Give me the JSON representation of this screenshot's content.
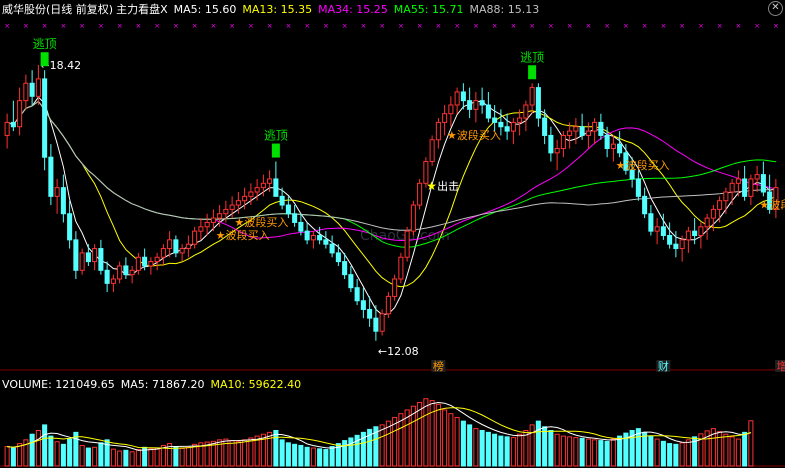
{
  "header": {
    "stock_name": "威华股份(日线 前复权)",
    "indicator_name": "主力看盘X",
    "ma": [
      {
        "label": "MA5: 15.60",
        "color": "#ffffff"
      },
      {
        "label": "MA13: 15.35",
        "color": "#ffff00"
      },
      {
        "label": "MA34: 15.25",
        "color": "#ff00ff"
      },
      {
        "label": "MA55: 15.71",
        "color": "#00ff00"
      },
      {
        "label": "MA88: 15.13",
        "color": "#c0c0c0"
      }
    ],
    "close_icon": "close-x-icon"
  },
  "price_panel": {
    "high_label": "18.42",
    "low_label": "12.08",
    "watermark": "ChaoGu.com",
    "markers_top": [
      {
        "text": "逃顶",
        "bar": 6
      },
      {
        "text": "逃顶",
        "bar": 43
      },
      {
        "text": "逃顶",
        "bar": 84
      }
    ],
    "markers_buy": [
      {
        "text": "波段买入",
        "bar": 37
      },
      {
        "text": "波段买入",
        "bar": 71
      },
      {
        "text": "波段买入",
        "bar": 98
      },
      {
        "text": "波段买入",
        "bar": 121
      },
      {
        "text": "波段买入",
        "bar": 34
      }
    ],
    "marker_attack": {
      "text": "出击",
      "bar": 68
    },
    "event_tags": [
      {
        "text": "榜",
        "bar": 69
      },
      {
        "text": "财",
        "bar": 105
      },
      {
        "text": "增",
        "bar": 124
      }
    ]
  },
  "volume_panel": {
    "volume_label": "VOLUME: 121049.65",
    "ma5_label": "MA5: 71867.20",
    "ma10_label": "MA10: 59622.40"
  },
  "colors": {
    "up": "#ff3232",
    "down": "#54ffff",
    "grid": "#800000",
    "ma5": "#ffffff",
    "ma13": "#ffff00",
    "ma34": "#ff00ff",
    "ma55": "#00ff00",
    "ma88": "#c0c0c0",
    "top_marker": "#00e000",
    "buy_marker": "#ff9900"
  },
  "chart_data": {
    "type": "candlestick",
    "ylim": [
      11.5,
      19.5
    ],
    "ohlc": [
      [
        16.8,
        17.3,
        16.5,
        17.1
      ],
      [
        17.1,
        17.6,
        16.9,
        17.0
      ],
      [
        17.0,
        17.9,
        16.8,
        17.6
      ],
      [
        17.6,
        18.2,
        17.4,
        18.0
      ],
      [
        18.0,
        18.3,
        17.5,
        17.7
      ],
      [
        17.7,
        18.42,
        17.5,
        18.1
      ],
      [
        18.1,
        18.3,
        16.0,
        16.3
      ],
      [
        16.3,
        16.6,
        15.2,
        15.4
      ],
      [
        15.4,
        15.8,
        15.0,
        15.6
      ],
      [
        15.6,
        15.9,
        14.8,
        15.0
      ],
      [
        15.0,
        15.3,
        14.2,
        14.4
      ],
      [
        14.4,
        14.6,
        13.5,
        13.7
      ],
      [
        13.7,
        14.2,
        13.6,
        14.1
      ],
      [
        14.1,
        14.3,
        13.8,
        13.9
      ],
      [
        13.9,
        14.3,
        13.7,
        14.2
      ],
      [
        14.2,
        14.4,
        13.6,
        13.7
      ],
      [
        13.7,
        13.9,
        13.2,
        13.4
      ],
      [
        13.4,
        13.6,
        13.2,
        13.5
      ],
      [
        13.5,
        13.9,
        13.4,
        13.8
      ],
      [
        13.8,
        14.0,
        13.5,
        13.6
      ],
      [
        13.6,
        13.8,
        13.4,
        13.7
      ],
      [
        13.7,
        14.1,
        13.6,
        14.0
      ],
      [
        14.0,
        14.2,
        13.7,
        13.8
      ],
      [
        13.8,
        14.0,
        13.6,
        13.9
      ],
      [
        13.9,
        14.1,
        13.7,
        14.0
      ],
      [
        14.0,
        14.3,
        13.8,
        14.2
      ],
      [
        14.2,
        14.6,
        14.0,
        14.4
      ],
      [
        14.4,
        14.5,
        14.0,
        14.1
      ],
      [
        14.1,
        14.3,
        13.9,
        14.2
      ],
      [
        14.2,
        14.5,
        14.0,
        14.3
      ],
      [
        14.3,
        14.7,
        14.2,
        14.6
      ],
      [
        14.6,
        14.9,
        14.4,
        14.7
      ],
      [
        14.7,
        15.0,
        14.5,
        14.8
      ],
      [
        14.8,
        15.1,
        14.6,
        14.9
      ],
      [
        14.9,
        15.2,
        14.7,
        15.0
      ],
      [
        15.0,
        15.3,
        14.8,
        15.1
      ],
      [
        15.1,
        15.4,
        14.9,
        15.2
      ],
      [
        15.2,
        15.5,
        15.0,
        15.3
      ],
      [
        15.3,
        15.6,
        15.1,
        15.4
      ],
      [
        15.4,
        15.7,
        15.2,
        15.5
      ],
      [
        15.5,
        15.8,
        15.3,
        15.6
      ],
      [
        15.6,
        15.9,
        15.4,
        15.7
      ],
      [
        15.7,
        16.0,
        15.5,
        15.8
      ],
      [
        15.8,
        16.2,
        15.6,
        15.4
      ],
      [
        15.4,
        15.6,
        15.1,
        15.2
      ],
      [
        15.2,
        15.4,
        14.9,
        15.0
      ],
      [
        15.0,
        15.2,
        14.7,
        14.8
      ],
      [
        14.8,
        15.0,
        14.5,
        14.6
      ],
      [
        14.6,
        14.8,
        14.3,
        14.4
      ],
      [
        14.4,
        14.6,
        14.2,
        14.5
      ],
      [
        14.5,
        14.7,
        14.3,
        14.4
      ],
      [
        14.4,
        14.6,
        14.2,
        14.3
      ],
      [
        14.3,
        14.5,
        14.0,
        14.1
      ],
      [
        14.1,
        14.3,
        13.8,
        13.9
      ],
      [
        13.9,
        14.1,
        13.5,
        13.6
      ],
      [
        13.6,
        13.8,
        13.2,
        13.3
      ],
      [
        13.3,
        13.5,
        12.9,
        13.0
      ],
      [
        13.0,
        13.3,
        12.6,
        12.8
      ],
      [
        12.8,
        13.1,
        12.4,
        12.6
      ],
      [
        12.6,
        12.9,
        12.08,
        12.3
      ],
      [
        12.3,
        12.8,
        12.2,
        12.7
      ],
      [
        12.7,
        13.2,
        12.6,
        13.1
      ],
      [
        13.1,
        13.6,
        13.0,
        13.5
      ],
      [
        13.5,
        14.1,
        13.4,
        14.0
      ],
      [
        14.0,
        14.7,
        13.9,
        14.6
      ],
      [
        14.6,
        15.3,
        14.5,
        15.2
      ],
      [
        15.2,
        15.8,
        15.1,
        15.7
      ],
      [
        15.7,
        16.3,
        15.6,
        16.2
      ],
      [
        16.2,
        16.8,
        16.1,
        16.7
      ],
      [
        16.7,
        17.2,
        16.5,
        17.1
      ],
      [
        17.1,
        17.5,
        16.8,
        17.3
      ],
      [
        17.3,
        17.7,
        17.0,
        17.5
      ],
      [
        17.5,
        17.9,
        17.3,
        17.8
      ],
      [
        17.8,
        18.0,
        17.4,
        17.6
      ],
      [
        17.6,
        17.9,
        17.2,
        17.4
      ],
      [
        17.4,
        17.8,
        17.1,
        17.6
      ],
      [
        17.6,
        17.9,
        17.3,
        17.5
      ],
      [
        17.5,
        17.8,
        17.1,
        17.2
      ],
      [
        17.2,
        17.5,
        16.9,
        17.1
      ],
      [
        17.1,
        17.4,
        16.8,
        17.0
      ],
      [
        17.0,
        17.3,
        16.7,
        16.9
      ],
      [
        16.9,
        17.2,
        16.6,
        17.1
      ],
      [
        17.1,
        17.4,
        16.8,
        17.2
      ],
      [
        17.2,
        17.6,
        16.9,
        17.5
      ],
      [
        17.5,
        18.0,
        17.3,
        17.9
      ],
      [
        17.9,
        18.0,
        17.0,
        17.2
      ],
      [
        17.2,
        17.4,
        16.6,
        16.8
      ],
      [
        16.8,
        17.0,
        16.2,
        16.4
      ],
      [
        16.4,
        16.7,
        16.0,
        16.5
      ],
      [
        16.5,
        16.9,
        16.3,
        16.8
      ],
      [
        16.8,
        17.1,
        16.5,
        16.9
      ],
      [
        16.9,
        17.2,
        16.6,
        17.0
      ],
      [
        17.0,
        17.3,
        16.7,
        16.8
      ],
      [
        16.8,
        17.1,
        16.5,
        16.9
      ],
      [
        16.9,
        17.2,
        16.6,
        17.1
      ],
      [
        17.1,
        17.3,
        16.7,
        16.8
      ],
      [
        16.8,
        17.0,
        16.3,
        16.5
      ],
      [
        16.5,
        16.8,
        16.2,
        16.6
      ],
      [
        16.6,
        16.9,
        16.3,
        16.4
      ],
      [
        16.4,
        16.6,
        15.9,
        16.0
      ],
      [
        16.0,
        16.3,
        15.6,
        15.8
      ],
      [
        15.8,
        16.0,
        15.3,
        15.4
      ],
      [
        15.4,
        15.6,
        14.9,
        15.0
      ],
      [
        15.0,
        15.2,
        14.5,
        14.6
      ],
      [
        14.6,
        14.9,
        14.3,
        14.7
      ],
      [
        14.7,
        15.0,
        14.4,
        14.5
      ],
      [
        14.5,
        14.8,
        14.2,
        14.3
      ],
      [
        14.3,
        14.6,
        14.0,
        14.2
      ],
      [
        14.2,
        14.5,
        13.9,
        14.4
      ],
      [
        14.4,
        14.7,
        14.1,
        14.6
      ],
      [
        14.6,
        14.9,
        14.3,
        14.5
      ],
      [
        14.5,
        14.8,
        14.2,
        14.7
      ],
      [
        14.7,
        15.0,
        14.4,
        14.9
      ],
      [
        14.9,
        15.2,
        14.6,
        15.1
      ],
      [
        15.1,
        15.4,
        14.8,
        15.3
      ],
      [
        15.3,
        15.6,
        15.0,
        15.5
      ],
      [
        15.5,
        15.8,
        15.2,
        15.7
      ],
      [
        15.7,
        16.0,
        15.4,
        15.8
      ],
      [
        15.8,
        16.1,
        15.3,
        15.4
      ],
      [
        15.4,
        15.9,
        15.2,
        15.8
      ],
      [
        15.8,
        16.1,
        15.5,
        15.9
      ],
      [
        15.9,
        16.2,
        15.4,
        15.5
      ],
      [
        15.5,
        15.9,
        15.0,
        15.1
      ],
      [
        15.1,
        15.8,
        14.9,
        15.6
      ]
    ],
    "volume": [
      52,
      48,
      60,
      70,
      85,
      95,
      110,
      80,
      65,
      58,
      72,
      90,
      55,
      48,
      50,
      62,
      70,
      45,
      40,
      42,
      38,
      44,
      50,
      46,
      48,
      55,
      60,
      52,
      47,
      50,
      58,
      62,
      64,
      66,
      70,
      72,
      68,
      65,
      70,
      75,
      80,
      85,
      90,
      95,
      70,
      62,
      58,
      55,
      50,
      48,
      46,
      44,
      52,
      60,
      68,
      75,
      82,
      90,
      98,
      105,
      110,
      120,
      130,
      140,
      150,
      160,
      170,
      180,
      175,
      165,
      150,
      140,
      130,
      120,
      110,
      100,
      95,
      90,
      85,
      80,
      78,
      76,
      85,
      95,
      110,
      120,
      105,
      95,
      85,
      80,
      78,
      76,
      74,
      72,
      70,
      68,
      66,
      72,
      80,
      88,
      95,
      100,
      90,
      80,
      72,
      66,
      60,
      58,
      62,
      70,
      78,
      86,
      94,
      100,
      92,
      85,
      78,
      72,
      90,
      121
    ]
  }
}
